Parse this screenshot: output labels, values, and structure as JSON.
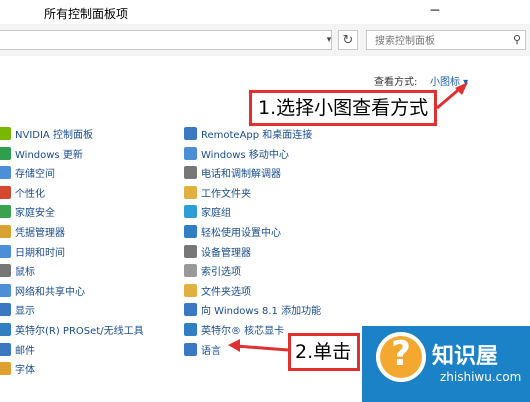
{
  "window": {
    "title": "所有控制面板项",
    "minimize": "─"
  },
  "toolbar": {
    "refresh_icon": "↻",
    "search_placeholder": "搜索控制面板",
    "search_icon": "⚲"
  },
  "view": {
    "label": "查看方式:",
    "value": "小图标 ▾"
  },
  "col1": [
    {
      "label": "NVIDIA 控制面板",
      "icon": "nvidia-icon",
      "color": "#76b900"
    },
    {
      "label": "Windows 更新",
      "icon": "windows-update-icon",
      "color": "#2f9e4f"
    },
    {
      "label": "存储空间",
      "icon": "storage-icon",
      "color": "#4c8fd6"
    },
    {
      "label": "个性化",
      "icon": "personalization-icon",
      "color": "#d2492e"
    },
    {
      "label": "家庭安全",
      "icon": "family-safety-icon",
      "color": "#3aa24f"
    },
    {
      "label": "凭据管理器",
      "icon": "credential-icon",
      "color": "#d8a230"
    },
    {
      "label": "日期和时间",
      "icon": "clock-icon",
      "color": "#4c8fd6"
    },
    {
      "label": "鼠标",
      "icon": "mouse-icon",
      "color": "#777777"
    },
    {
      "label": "网络和共享中心",
      "icon": "network-icon",
      "color": "#4c8fd6"
    },
    {
      "label": "显示",
      "icon": "display-icon",
      "color": "#3b78c4"
    },
    {
      "label": "英特尔(R) PROSet/无线工具",
      "icon": "intel-wireless-icon",
      "color": "#2f7fc1"
    },
    {
      "label": "邮件",
      "icon": "mail-icon",
      "color": "#3b78c4"
    },
    {
      "label": "字体",
      "icon": "font-icon",
      "color": "#e0a030"
    }
  ],
  "col2": [
    {
      "label": "RemoteApp 和桌面连接",
      "icon": "remoteapp-icon",
      "color": "#3b78c4"
    },
    {
      "label": "Windows 移动中心",
      "icon": "mobility-center-icon",
      "color": "#4c8fd6"
    },
    {
      "label": "电话和调制解调器",
      "icon": "phone-icon",
      "color": "#777777"
    },
    {
      "label": "工作文件夹",
      "icon": "folder-icon",
      "color": "#e0b040"
    },
    {
      "label": "家庭组",
      "icon": "homegroup-icon",
      "color": "#2f9ed6"
    },
    {
      "label": "轻松使用设置中心",
      "icon": "ease-of-access-icon",
      "color": "#2f7fc1"
    },
    {
      "label": "设备管理器",
      "icon": "device-manager-icon",
      "color": "#777777"
    },
    {
      "label": "索引选项",
      "icon": "indexing-icon",
      "color": "#999999"
    },
    {
      "label": "文件夹选项",
      "icon": "folder-options-icon",
      "color": "#e0b040"
    },
    {
      "label": "向 Windows 8.1 添加功能",
      "icon": "add-features-icon",
      "color": "#3b78c4"
    },
    {
      "label": "英特尔® 核芯显卡",
      "icon": "intel-graphics-icon",
      "color": "#2f7fc1"
    },
    {
      "label": "语言",
      "icon": "language-icon",
      "color": "#3b78c4"
    }
  ],
  "annotations": {
    "step1": "1.选择小图查看方式",
    "step2": "2.单击"
  },
  "watermark": {
    "logo_char": "?",
    "name": "知识屋",
    "url": "zhishiwu.com"
  }
}
